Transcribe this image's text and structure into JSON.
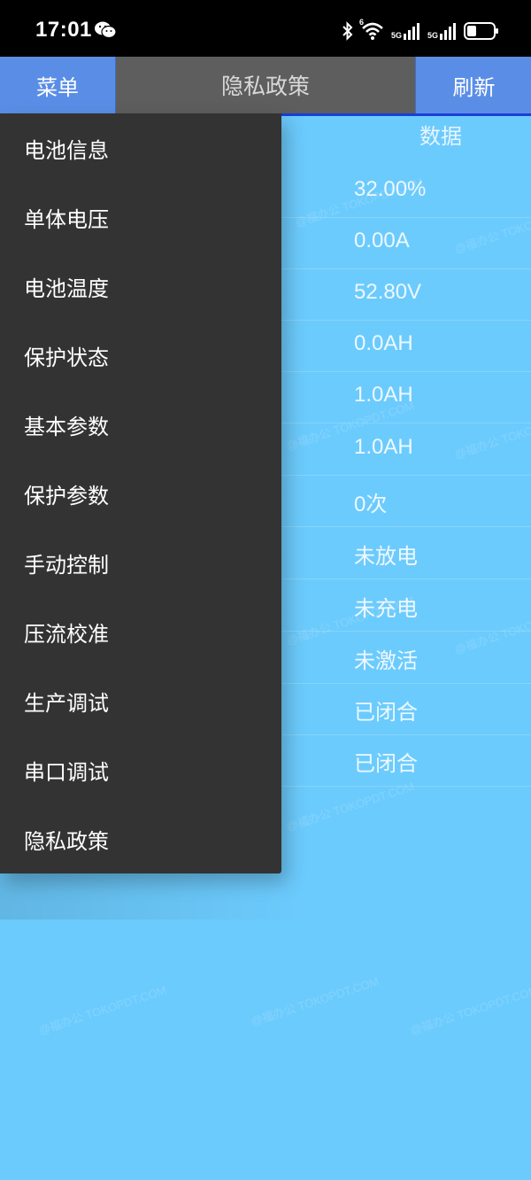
{
  "status_bar": {
    "time": "17:01",
    "net1": "5G",
    "net2": "5G",
    "wifi_sup": "6"
  },
  "nav": {
    "menu_label": "菜单",
    "title": "隐私政策",
    "refresh_label": "刷新"
  },
  "table": {
    "column_header": "数据",
    "values": [
      "32.00%",
      "0.00A",
      "52.80V",
      "0.0AH",
      "1.0AH",
      "1.0AH",
      "0次",
      "未放电",
      "未充电",
      "未激活",
      "已闭合",
      "已闭合"
    ]
  },
  "drawer": {
    "items": [
      "电池信息",
      "单体电压",
      "电池温度",
      "保护状态",
      "基本参数",
      "保护参数",
      "手动控制",
      "压流校准",
      "生产调试",
      "串口调试",
      "隐私政策"
    ]
  },
  "watermark_text": "@福办公 TOKOPDT.COM",
  "colors": {
    "background": "#6ccbfd",
    "nav_button": "#5a8ee6",
    "nav_title_bg": "#5e5e5e",
    "drawer_bg": "#333333",
    "accent_line": "#1a3fd6"
  }
}
